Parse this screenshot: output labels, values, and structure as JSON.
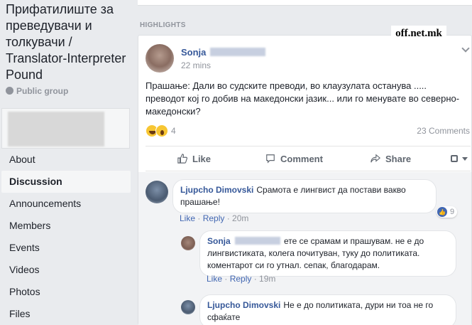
{
  "group": {
    "title": "Прифатилиште за преведувачи и толкувачи / Translator-Interpreter Pound",
    "privacy": "Public group"
  },
  "nav": {
    "items": [
      {
        "label": "About",
        "active": false
      },
      {
        "label": "Discussion",
        "active": true
      },
      {
        "label": "Announcements",
        "active": false
      },
      {
        "label": "Members",
        "active": false
      },
      {
        "label": "Events",
        "active": false
      },
      {
        "label": "Videos",
        "active": false
      },
      {
        "label": "Photos",
        "active": false
      },
      {
        "label": "Files",
        "active": false
      }
    ]
  },
  "feed": {
    "section_label": "HIGHLIGHTS"
  },
  "post": {
    "author": "Sonja",
    "time": "22 mins",
    "text": "Прашање: Дали во судските преводи, во клаузулата останува ..... преводот кој го добив на македонски јазик... или го менувате во северно-македонски?",
    "reaction_count": "4",
    "reactions": [
      "haha-icon",
      "wow-icon"
    ],
    "comment_count": "23 Comments",
    "actions": {
      "like": "Like",
      "comment": "Comment",
      "share": "Share"
    }
  },
  "comments": [
    {
      "author": "Ljupcho Dimovski",
      "text": "Срамота е лингвист да постави вакво прашање!",
      "like": "Like",
      "reply": "Reply",
      "time": "20m",
      "likes": "9"
    },
    {
      "author": "Sonja",
      "text": "ете се срамам и прашувам. не е до лингвистиката, колега почитуван, туку до политиката. коментарот си го утнал. сепак, благодарам.",
      "like": "Like",
      "reply": "Reply",
      "time": "19m"
    },
    {
      "author": "Ljupcho Dimovski",
      "text": "Не е до политиката, дури ни тоа не го сфаќате"
    }
  ],
  "watermark": "off.net.mk",
  "colors": {
    "background": "#e9ebee",
    "link": "#365899",
    "accent": "#4267b2",
    "muted": "#90949c"
  }
}
